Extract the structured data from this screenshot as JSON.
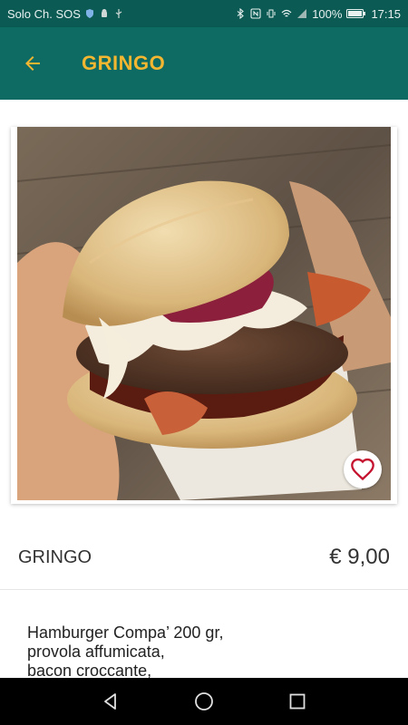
{
  "status_bar": {
    "carrier": "Solo Ch. SOS",
    "battery": "100%",
    "time": "17:15"
  },
  "app_bar": {
    "title": "GRINGO",
    "back_icon": "arrow-back-icon"
  },
  "product": {
    "name": "GRINGO",
    "price": "€ 9,00",
    "image_description": "burger-photo",
    "favorite_icon": "heart-outline-icon",
    "description_lines": [
      "Hamburger Compa’ 200 gr,",
      "provola affumicata,",
      "bacon croccante,"
    ]
  },
  "colors": {
    "status_bar": "#0b5a54",
    "app_bar": "#0e6b64",
    "accent": "#f2b631",
    "favorite": "#c4122f"
  },
  "nav_bar": {
    "back": "triangle-back-icon",
    "home": "circle-home-icon",
    "recents": "square-recents-icon"
  }
}
